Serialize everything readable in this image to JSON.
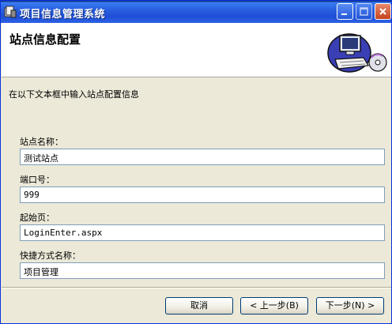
{
  "window": {
    "title": "项目信息管理系统",
    "controls": {
      "minimize": "minimize",
      "maximize": "maximize",
      "close": "close"
    }
  },
  "header": {
    "title": "站点信息配置",
    "icon": "computer-setup-icon"
  },
  "description": "在以下文本框中输入站点配置信息",
  "fields": [
    {
      "label": "站点名称：",
      "value": "测试站点"
    },
    {
      "label": "端口号：",
      "value": "999"
    },
    {
      "label": "起始页：",
      "value": "LoginEnter.aspx"
    },
    {
      "label": "快捷方式名称：",
      "value": "项目管理"
    }
  ],
  "buttons": {
    "cancel": "取消",
    "back": "< 上一步(B)",
    "next": "下一步(N) >"
  }
}
